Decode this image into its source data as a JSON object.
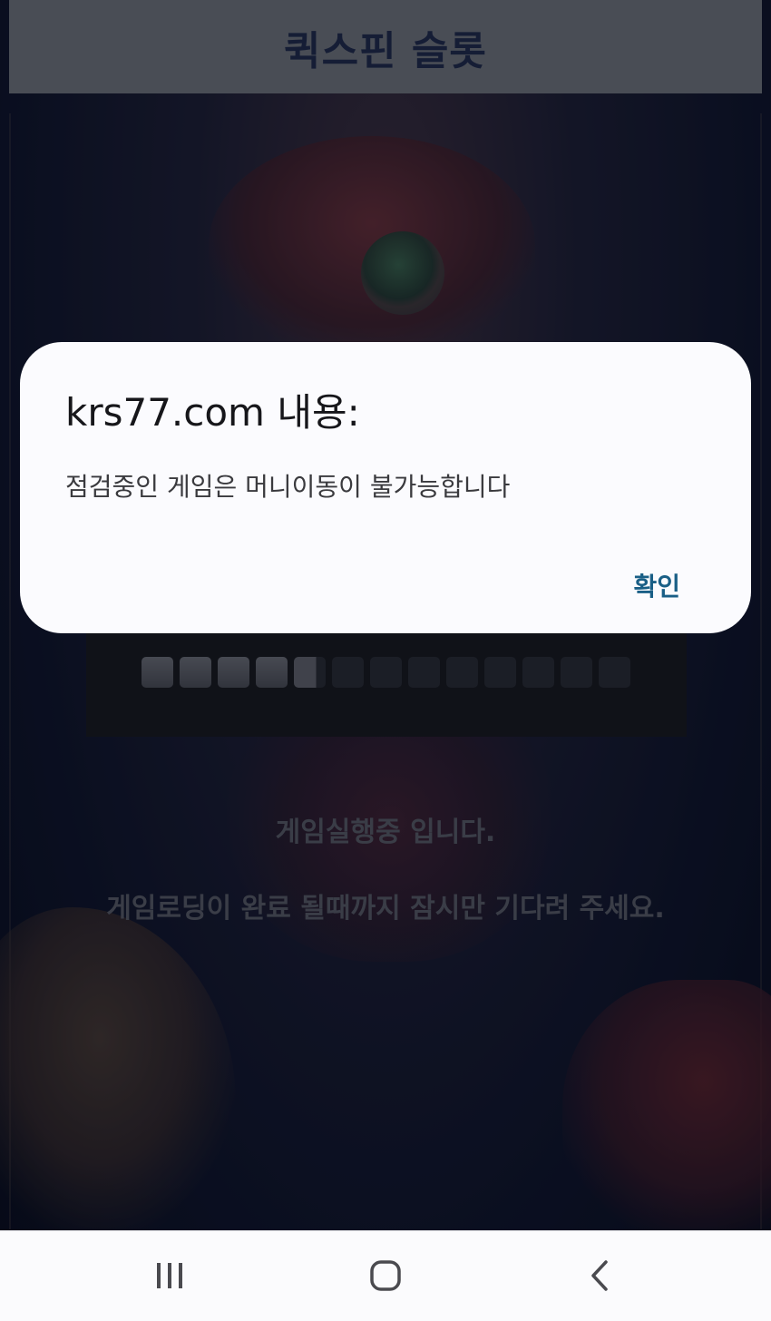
{
  "header": {
    "title": "퀵스핀 슬롯"
  },
  "loading": {
    "progress": {
      "segments_total": 13,
      "segments_filled": 4.7
    },
    "line1": "게임실행중 입니다.",
    "line2": "게임로딩이 완료 될때까지 잠시만 기다려 주세요."
  },
  "dialog": {
    "title": "krs77.com 내용:",
    "message": "점검중인 게임은 머니이동이 불가능합니다",
    "ok_label": "확인"
  },
  "nav": {
    "recent_icon": "recent-apps-icon",
    "home_icon": "home-icon",
    "back_icon": "back-icon"
  },
  "colors": {
    "title_bar": "#6c6f74",
    "title_text": "#1c2642",
    "dialog_bg": "#fbfbfe",
    "ok_text": "#1a5f86"
  }
}
